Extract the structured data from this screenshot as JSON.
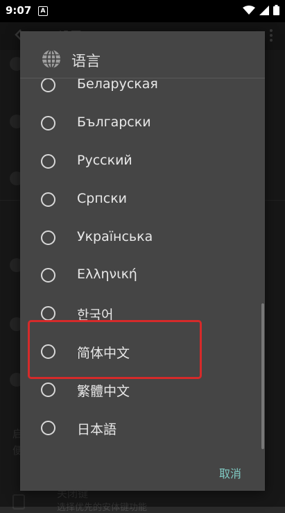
{
  "status_bar": {
    "time": "9:07",
    "notif_glyph": "A"
  },
  "background": {
    "toolbar_title": "设置",
    "rows": [
      "启",
      "便",
      "关闭键",
      "选择优先的安体键功能"
    ]
  },
  "dialog": {
    "title": "语言",
    "title_icon": "globe-icon",
    "options": [
      "Беларуская",
      "Български",
      "Русский",
      "Српски",
      "Українська",
      "Ελληνική",
      "한국어",
      "简体中文",
      "繁體中文",
      "日本語"
    ],
    "cancel_label": "取消"
  },
  "colors": {
    "dialog_bg": "#454545",
    "accent": "#80cbc4",
    "highlight_box": "#d62a2a"
  }
}
